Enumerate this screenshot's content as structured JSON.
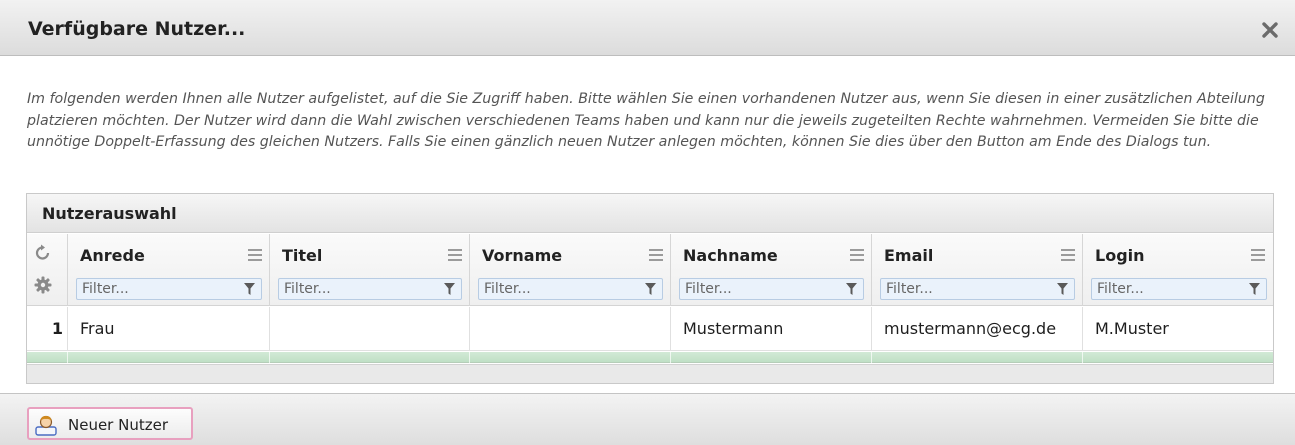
{
  "dialog": {
    "title": "Verfügbare Nutzer...",
    "description": "Im folgenden werden Ihnen alle Nutzer aufgelistet, auf die Sie Zugriff haben. Bitte wählen Sie einen vorhandenen Nutzer aus, wenn Sie diesen in einer zusätzlichen Abteilung platzieren möchten. Der Nutzer wird dann die Wahl zwischen verschiedenen Teams haben und kann nur die jeweils zugeteilten Rechte wahrnehmen. Vermeiden Sie bitte die unnötige Doppelt-Erfassung des gleichen Nutzers. Falls Sie einen gänzlich neuen Nutzer anlegen möchten, können Sie dies über den Button am Ende des Dialogs tun."
  },
  "grid": {
    "title": "Nutzerauswahl",
    "filter_placeholder": "Filter...",
    "columns": [
      {
        "label": "Anrede"
      },
      {
        "label": "Titel"
      },
      {
        "label": "Vorname"
      },
      {
        "label": "Nachname"
      },
      {
        "label": "Email"
      },
      {
        "label": "Login"
      }
    ],
    "rows": [
      {
        "num": "1",
        "cells": [
          "Frau",
          "",
          "",
          "Mustermann",
          "mustermann@ecg.de",
          "M.Muster"
        ]
      }
    ]
  },
  "footer": {
    "new_user_label": "Neuer Nutzer"
  },
  "icons": {
    "close": "close-icon",
    "reset": "reset-icon",
    "settings": "gear-icon",
    "column_menu": "menu-icon",
    "filter": "filter-icon",
    "user": "user-icon"
  },
  "colors": {
    "selection_green": "#c6e4cb",
    "button_highlight": "#e8a0bf",
    "filter_bg": "#eaf2fb"
  }
}
